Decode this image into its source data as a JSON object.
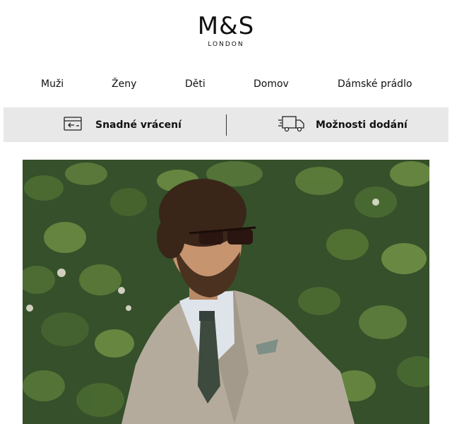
{
  "brand": {
    "name": "M&S",
    "sub": "LONDON"
  },
  "nav": {
    "items": [
      {
        "label": "Muži"
      },
      {
        "label": "Ženy"
      },
      {
        "label": "Děti"
      },
      {
        "label": "Domov"
      },
      {
        "label": "Dámské prádlo"
      }
    ]
  },
  "info": {
    "returns_label": "Snadné vrácení",
    "returns_icon": "return-box-icon",
    "delivery_label": "Možnosti dodání",
    "delivery_icon": "delivery-truck-icon"
  },
  "hero": {
    "image": "man-in-beige-suit-sunglasses-hedge-background"
  },
  "colors": {
    "info_bar_bg": "#e8e8e8",
    "hedge_green": "#3c5a2c",
    "suit_beige": "#b5ab9c"
  }
}
